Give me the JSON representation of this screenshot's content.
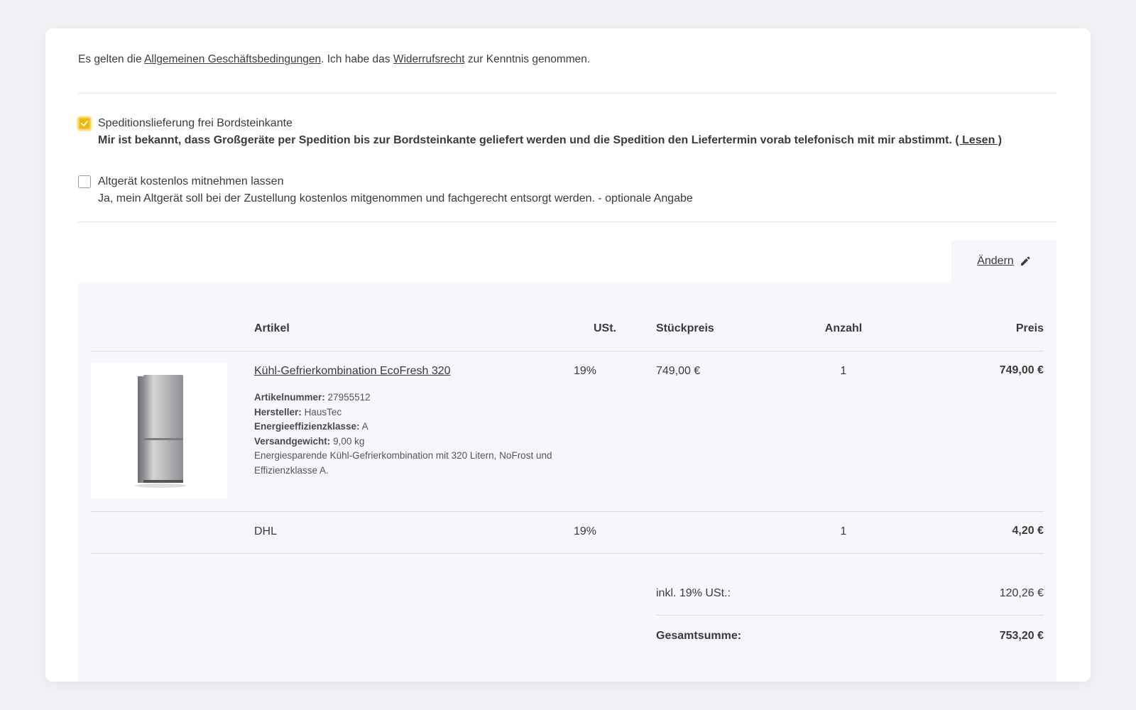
{
  "terms": {
    "prefix": "Es gelten die ",
    "agb_link": "Allgemeinen Geschäftsbedingungen",
    "middle": ". Ich habe das ",
    "widerruf_link": "Widerrufsrecht",
    "suffix": " zur Kenntnis genommen."
  },
  "options": [
    {
      "checked": true,
      "title": "Speditionslieferung frei Bordsteinkante",
      "description": "Mir ist bekannt, dass Großgeräte per Spedition bis zur Bordsteinkante geliefert werden und die Spedition den Liefertermin vorab telefonisch mit mir abstimmt. ",
      "link": "( Lesen )"
    },
    {
      "checked": false,
      "title": "Altgerät kostenlos mitnehmen lassen",
      "description": "Ja, mein Altgerät soll bei der Zustellung kostenlos mitgenommen und fachgerecht entsorgt werden. - optionale Angabe"
    }
  ],
  "edit": {
    "label": "Ändern",
    "icon": "pencil-icon"
  },
  "table": {
    "headers": {
      "article": "Artikel",
      "vat": "USt.",
      "unit_price": "Stückpreis",
      "quantity": "Anzahl",
      "price": "Preis"
    },
    "product": {
      "name": "Kühl-Gefrierkombination EcoFresh 320",
      "vat": "19%",
      "unit_price": "749,00 €",
      "quantity": "1",
      "price": "749,00 €",
      "article_number_label": "Artikelnummer:",
      "article_number": "27955512",
      "manufacturer_label": "Hersteller:",
      "manufacturer": "HausTec",
      "energy_label": "Energieeffizienzklasse:",
      "energy": "A",
      "weight_label": "Versandgewicht:",
      "weight": "9,00 kg",
      "description": "Energiesparende Kühl-Gefrierkombination mit 320 Litern, NoFrost und Effizienzklasse A."
    },
    "shipping": {
      "name": "DHL",
      "vat": "19%",
      "quantity": "1",
      "price": "4,20 €"
    },
    "totals": {
      "vat_label": "inkl. 19% USt.:",
      "vat_value": "120,26 €",
      "total_label": "Gesamtsumme:",
      "total_value": "753,20 €"
    }
  },
  "colors": {
    "accent": "#f2b705",
    "panel": "#f6f7fa",
    "background": "#f1f2f6"
  }
}
